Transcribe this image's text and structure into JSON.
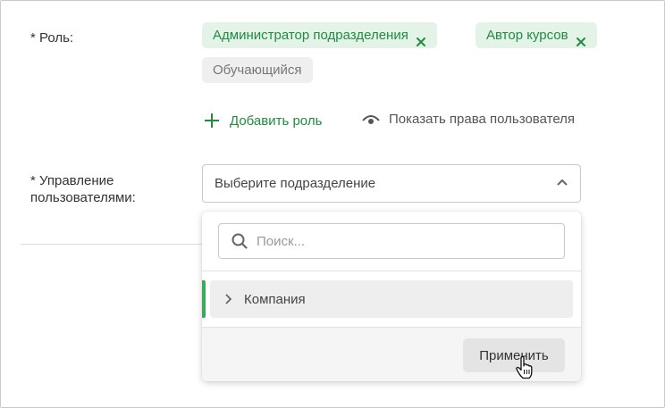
{
  "role_field": {
    "label": "* Роль:",
    "tags": [
      {
        "label": "Администратор подразделения",
        "removable": true
      },
      {
        "label": "Автор курсов",
        "removable": true
      },
      {
        "label": "Обучающийся",
        "removable": false
      }
    ],
    "add_role": "Добавить роль",
    "show_rights": "Показать права пользователя"
  },
  "management_field": {
    "label_line1": "* Управление",
    "label_line2": "пользователями:",
    "select_placeholder": "Выберите подразделение"
  },
  "dropdown": {
    "search_placeholder": "Поиск...",
    "tree_items": [
      {
        "label": "Компания"
      }
    ],
    "apply_label": "Применить"
  },
  "colors": {
    "accent_green": "#238a42",
    "tag_green_bg": "#e3f3e7",
    "tree_accent": "#3aaa5c"
  }
}
